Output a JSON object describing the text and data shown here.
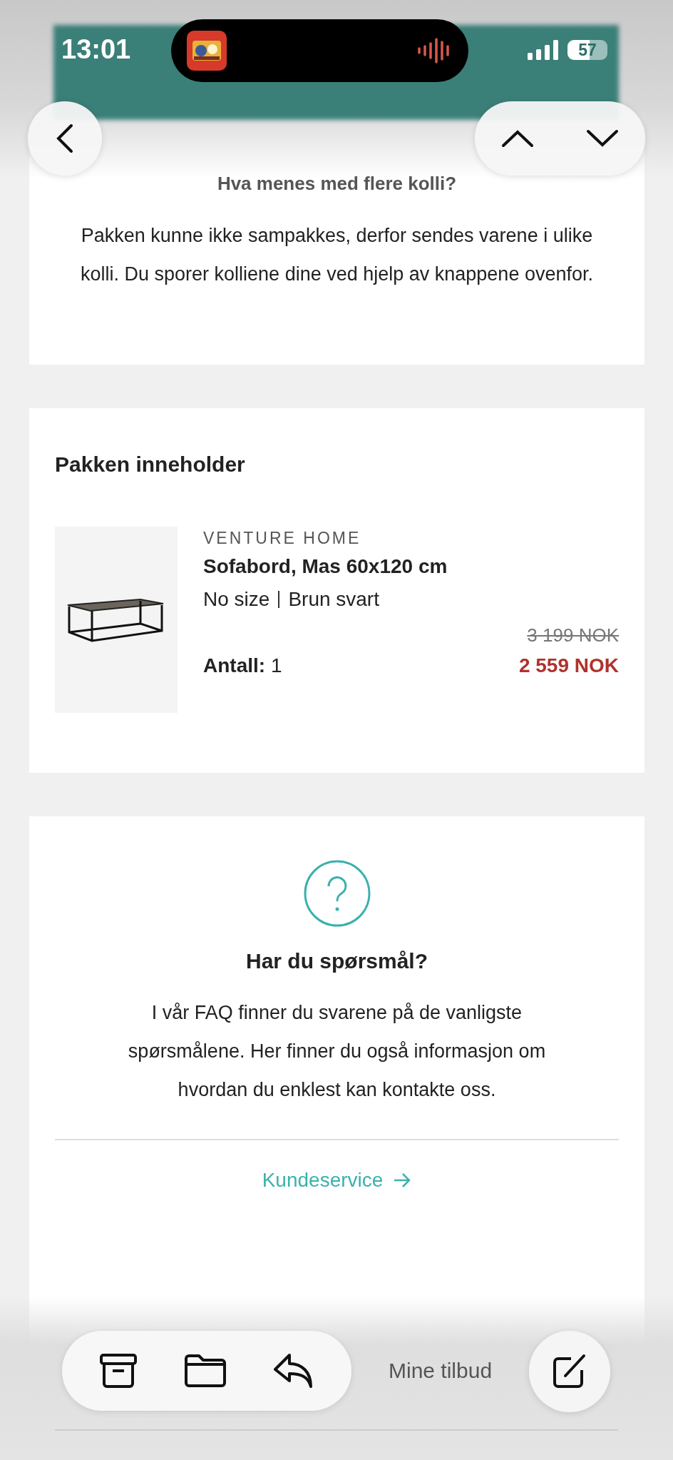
{
  "status_bar": {
    "time": "13:01",
    "battery": "57"
  },
  "faq_card": {
    "title": "Hva menes med flere kolli?",
    "text": "Pakken kunne ikke sampakkes, derfor sendes varene i ulike kolli. Du sporer kolliene dine ved hjelp av knappene ovenfor."
  },
  "package_card": {
    "heading": "Pakken inneholder",
    "items": [
      {
        "brand": "VENTURE HOME",
        "name": "Sofabord, Mas 60x120 cm",
        "size": "No size",
        "color_name": "Brun svart",
        "old_price": "3 199 NOK",
        "price": "2 559 NOK",
        "quantity_label": "Antall:",
        "quantity": "1"
      }
    ]
  },
  "help_card": {
    "title": "Har du spørsmål?",
    "text": "I vår FAQ finner du svarene på de vanligste spørsmålene. Her finner du også informasjon om hvordan du enklest kan kontakte oss.",
    "link": "Kundeservice"
  },
  "toolbar": {
    "label": "Mine tilbud"
  }
}
